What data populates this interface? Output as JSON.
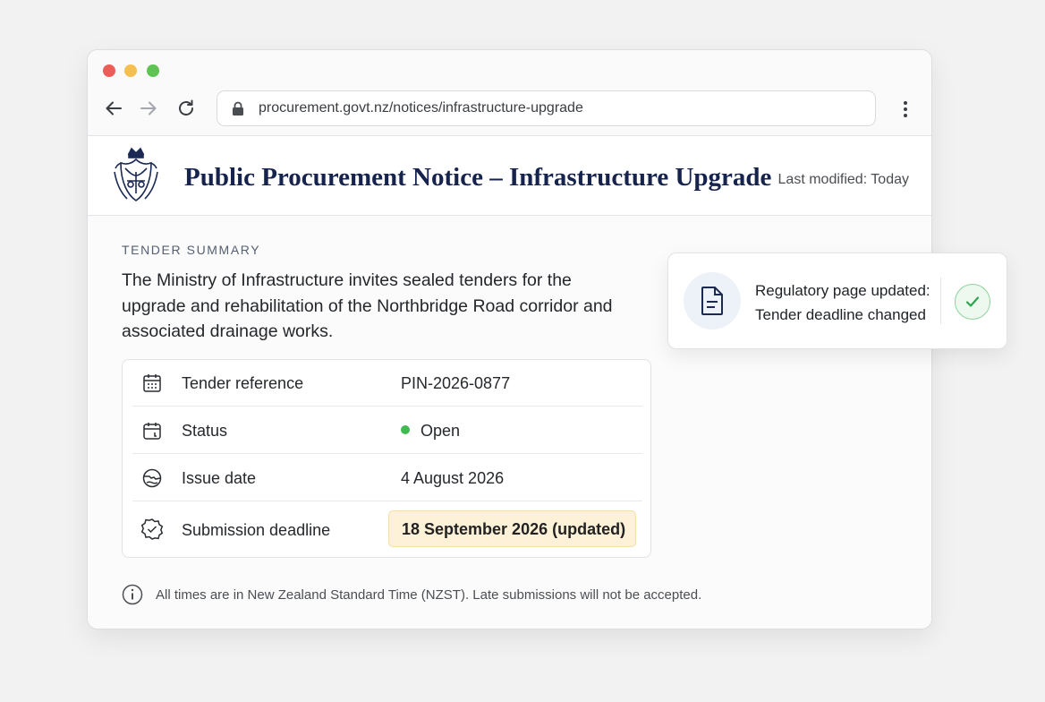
{
  "browser": {
    "url": "procurement.govt.nz/notices/infrastructure-upgrade"
  },
  "header": {
    "title": "Public Procurement Notice – Infrastructure Upgrade",
    "last_modified": "Last modified: Today"
  },
  "summary": {
    "section_label": "TENDER SUMMARY",
    "intro": "The Ministry of Infrastructure invites sealed tenders for the upgrade and rehabilitation of the Northbridge Road corridor and associated drainage works."
  },
  "details": {
    "rows": [
      {
        "label": "Tender reference",
        "value": "PIN-2026-0877",
        "icon": "calendar-grid-icon"
      },
      {
        "label": "Status",
        "value": "Open",
        "icon": "calendar-icon",
        "status_color": "#3fb950"
      },
      {
        "label": "Issue date",
        "value": "4 August 2026",
        "icon": "globe-icon"
      },
      {
        "label": "Submission deadline",
        "value": "18 September 2026 (updated)",
        "icon": "badge-check-icon",
        "highlight_color": "#fdf1d7"
      }
    ]
  },
  "footnote": {
    "text": "All times are in New Zealand Standard Time (NZST). Late submissions will not be accepted."
  },
  "notification": {
    "line1": "Regulatory page updated:",
    "line2": "Tender deadline changed",
    "icon": "document-icon",
    "status_icon": "check-icon"
  },
  "colors": {
    "title": "#16234d",
    "accent_green": "#3fb950",
    "highlight": "#fdf1d7"
  }
}
